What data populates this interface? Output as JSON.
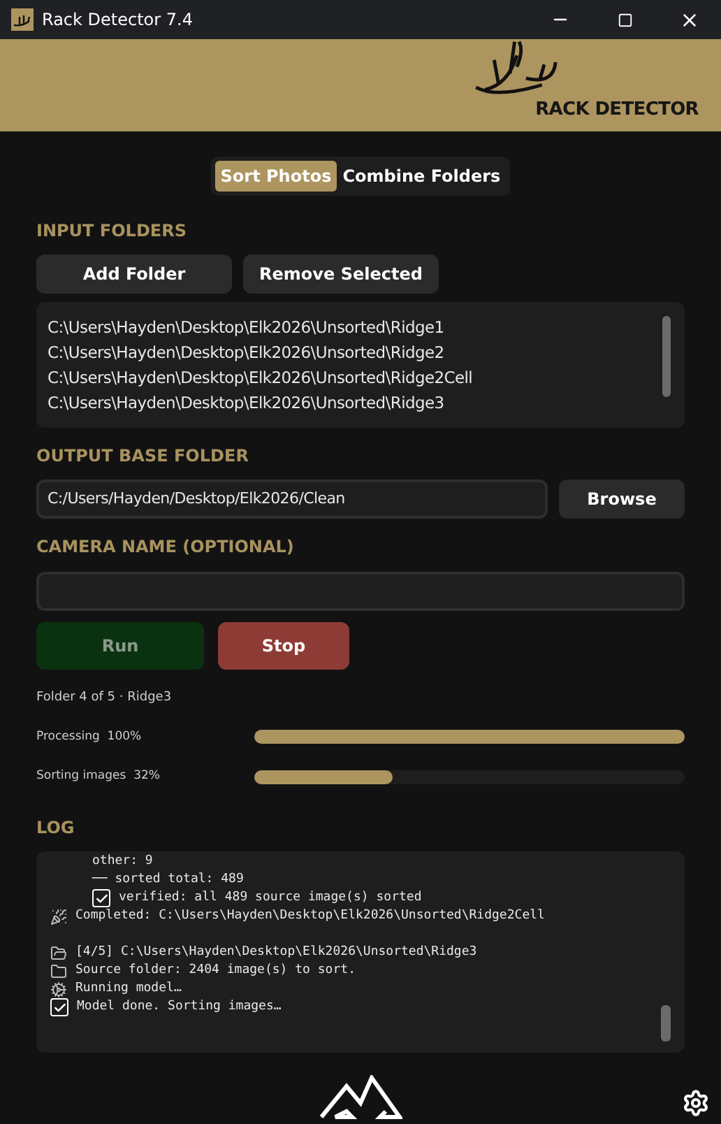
{
  "window": {
    "title": "Rack Detector 7.4"
  },
  "banner": {
    "logo_text": "RACK DETECTOR"
  },
  "tabs": [
    {
      "label": "Sort Photos",
      "selected": true
    },
    {
      "label": "Combine Folders",
      "selected": false
    }
  ],
  "input_folders": {
    "heading": "INPUT FOLDERS",
    "buttons": [
      "Add Folder",
      "Remove Selected"
    ],
    "items": [
      "C:\\Users\\Hayden\\Desktop\\Elk2026\\Unsorted\\Ridge1",
      "C:\\Users\\Hayden\\Desktop\\Elk2026\\Unsorted\\Ridge2",
      "C:\\Users\\Hayden\\Desktop\\Elk2026\\Unsorted\\Ridge2Cell",
      "C:\\Users\\Hayden\\Desktop\\Elk2026\\Unsorted\\Ridge3"
    ]
  },
  "output": {
    "heading": "OUTPUT BASE FOLDER",
    "value": "C:/Users/Hayden/Desktop/Elk2026/Clean",
    "button": "Browse"
  },
  "camera": {
    "heading": "CAMERA NAME (OPTIONAL)"
  },
  "actions": [
    {
      "label": "Run",
      "kind": "run",
      "disabled": true
    },
    {
      "label": "Stop",
      "kind": "stop",
      "disabled": false
    }
  ],
  "status": "Folder 4 of 5 · Ridge3",
  "progress": [
    {
      "label": "Processing  100%",
      "level": 1.0
    },
    {
      "label": "Sorting images  32%",
      "level": 0.32
    }
  ],
  "log": {
    "heading": "LOG",
    "lines": [
      {
        "text": "other: 9",
        "kind": "detail"
      },
      {
        "text": "── sorted total: 489",
        "kind": "detail"
      },
      {
        "text": "verified: all 489 source image(s) sorted",
        "kind": "verified"
      },
      {
        "text": "Completed: C:\\Users\\Hayden\\Desktop\\Elk2026\\Unsorted\\Ridge2Cell",
        "kind": "completed"
      },
      {
        "text": "[4/5] C:\\Users\\Hayden\\Desktop\\Elk2026\\Unsorted\\Ridge3",
        "kind": "folder"
      },
      {
        "text": "Source folder: 2404 image(s) to sort.",
        "kind": "source"
      },
      {
        "text": "Running model…",
        "kind": "model"
      },
      {
        "text": "Model done. Sorting images…",
        "kind": "done"
      }
    ]
  }
}
